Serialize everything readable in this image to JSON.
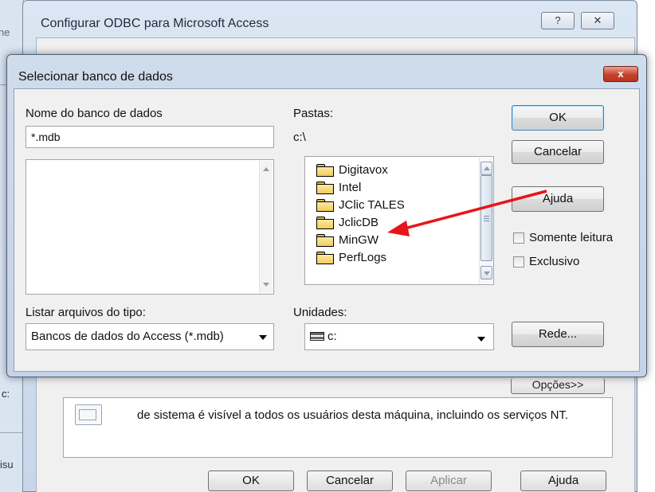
{
  "background_fragments": {
    "top_left": "ne",
    "mid_left": "c:",
    "bottom_left": "isu"
  },
  "odbc_window": {
    "title": "Configurar ODBC para Microsoft Access",
    "help_button": "?",
    "close_button": "✕",
    "options_button": "Opções>>",
    "info_text": "de sistema é visível a todos os usuários desta máquina, incluindo os serviços NT.",
    "buttons": {
      "ok": "OK",
      "cancel": "Cancelar",
      "apply": "Aplicar",
      "help": "Ajuda"
    }
  },
  "dialog": {
    "title": "Selecionar banco de dados",
    "close_button": "x",
    "database_name_label": "Nome do banco de dados",
    "database_name_value": "*.mdb",
    "folders_label": "Pastas:",
    "current_path": "c:\\",
    "folders": [
      "Digitavox",
      "Intel",
      "JClic TALES",
      "JclicDB",
      "MinGW",
      "PerfLogs"
    ],
    "file_type_label": "Listar arquivos do tipo:",
    "file_type_value": "Bancos de dados do Access (*.mdb)",
    "drives_label": "Unidades:",
    "drive_value": "c:",
    "buttons": {
      "ok": "OK",
      "cancel": "Cancelar",
      "help": "Ajuda",
      "network": "Rede..."
    },
    "checkboxes": {
      "read_only": "Somente leitura",
      "exclusive": "Exclusivo"
    }
  },
  "annotation": {
    "arrow_color": "#e8141b",
    "points_to": "JclicDB"
  }
}
